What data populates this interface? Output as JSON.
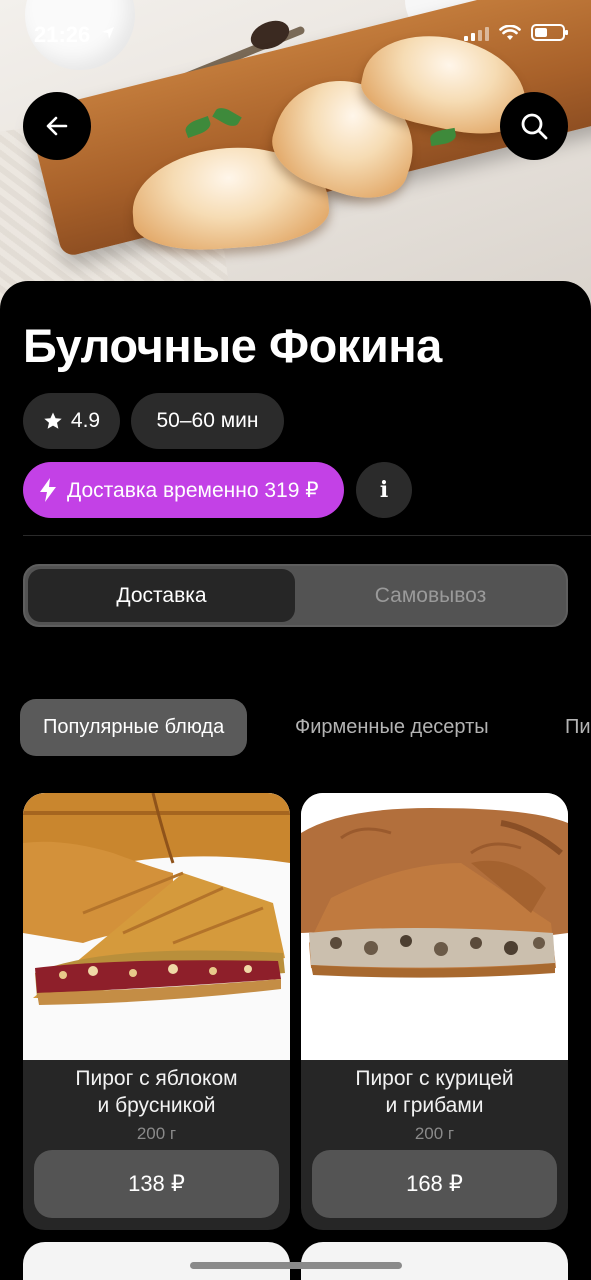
{
  "status_bar": {
    "time": "21:26"
  },
  "restaurant": {
    "name": "Булочные Фокина",
    "rating": "4.9",
    "delivery_time": "50–60 мин",
    "delivery_fee_label": "Доставка временно 319 ₽",
    "info_label": "i"
  },
  "segment": {
    "delivery": "Доставка",
    "pickup": "Самовывоз"
  },
  "categories": [
    "Популярные блюда",
    "Фирменные десерты",
    "Пи"
  ],
  "products": [
    {
      "name_line1": "Пирог с яблоком",
      "name_line2": "и брусникой",
      "weight": "200 г",
      "price": "138 ₽"
    },
    {
      "name_line1": "Пирог с курицей",
      "name_line2": "и грибами",
      "weight": "200 г",
      "price": "168 ₽"
    }
  ],
  "colors": {
    "accent": "#c341e6",
    "background": "#000000",
    "card": "#262626",
    "chip": "#2b2b2b"
  },
  "icons": [
    "back-arrow-icon",
    "search-icon",
    "star-icon",
    "lightning-icon",
    "info-icon",
    "location-arrow-icon",
    "signal-icon",
    "wifi-icon",
    "battery-icon"
  ]
}
